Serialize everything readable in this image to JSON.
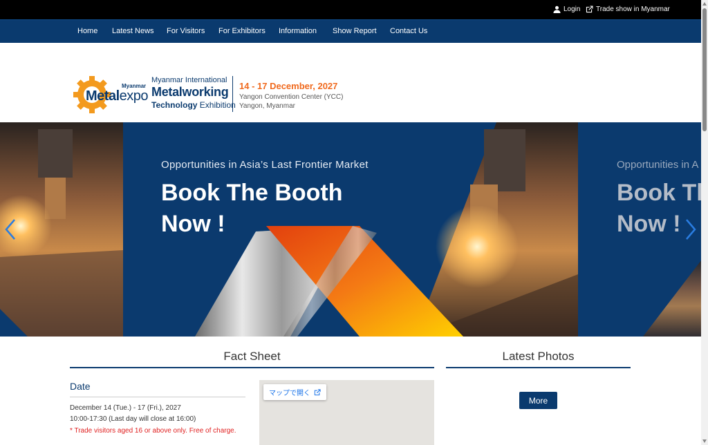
{
  "topbar": {
    "login_label": "Login",
    "tradeshow_label": "Trade show in Myanmar"
  },
  "nav": {
    "items": [
      "Home",
      "Latest News",
      "For Visitors",
      "For Exhibitors",
      "Information",
      "Show Report",
      "Contact Us"
    ]
  },
  "logo": {
    "myanmar_small": "Myanmar",
    "metal": "Metal",
    "expo": "expo",
    "title_line1": "Myanmar International",
    "title_line2": "Metalworking",
    "title_line3_bold": "Technology",
    "title_line3_rest": " Exhibition",
    "dates": "14 - 17 December, 2027",
    "venue_line1": "Yangon Convention Center (YCC)",
    "venue_line2": "Yangon, Myanmar"
  },
  "banner": {
    "subtitle": "Opportunities in Asia’s Last Frontier Market",
    "headline_line1": "Book The Booth",
    "headline_line2": "Now !",
    "ghost_subtitle": "Opportunities in A",
    "ghost_headline_line1": "Book Th",
    "ghost_headline_line2": "Now !"
  },
  "fact_sheet": {
    "title": "Fact Sheet",
    "date_heading": "Date",
    "date_line1": "December 14 (Tue.) - 17 (Fri.), 2027",
    "date_line2": "10:00-17:30 (Last day will close at 16:00)",
    "date_note": "* Trade visitors aged 16 or above only. Free of charge.",
    "map_button_label": "マップで開く"
  },
  "latest_photos": {
    "title": "Latest Photos",
    "more_label": "More"
  },
  "colors": {
    "brand_navy": "#0a3a6e",
    "accent_orange": "#f06a1e",
    "note_red": "#e02020"
  }
}
